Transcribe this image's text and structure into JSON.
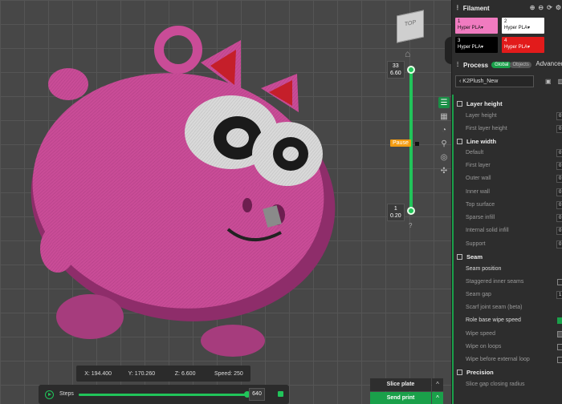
{
  "toolbar": {
    "view_cube_label": "TOP",
    "home_icon": "home-icon",
    "tools": [
      "layers-icon",
      "grid-icon",
      "speed-icon",
      "move-icon",
      "globe-icon",
      "group-icon"
    ]
  },
  "layer_slider": {
    "top_layer": "33",
    "top_height": "6.60",
    "bottom_layer": "1",
    "bottom_height": "0.20",
    "pause_label": "Pause",
    "help_mark": "?"
  },
  "coords": {
    "x": "X: 194.400",
    "y": "Y: 170.260",
    "z": "Z: 6.600",
    "speed": "Speed: 250"
  },
  "steps": {
    "label": "Steps",
    "value": "640",
    "progress_fraction": 1.0
  },
  "actions": {
    "slice_plate": "Slice plate",
    "send_print": "Send print",
    "caret": "^"
  },
  "filament": {
    "title": "Filament",
    "slots": [
      {
        "num": "1",
        "material": "Hyper PLA▾",
        "color": "#f07bc0"
      },
      {
        "num": "2",
        "material": "Hyper PLA▾",
        "color": "#ffffff"
      },
      {
        "num": "3",
        "material": "Hyper PLA▾",
        "color": "#000000"
      },
      {
        "num": "4",
        "material": "Hyper PLA▾",
        "color": "#e21b1b"
      }
    ]
  },
  "process": {
    "title": "Process",
    "global_label": "Global",
    "objects_label": "Objects",
    "advanced_label": "Advanced",
    "preset": "K2Plush_New"
  },
  "settings": {
    "layer_height_title": "Layer height",
    "layer_height": "Layer height",
    "first_layer_height": "First layer height",
    "line_width_title": "Line width",
    "default": "Default",
    "first_layer": "First layer",
    "outer_wall": "Outer wall",
    "inner_wall": "Inner wall",
    "top_surface": "Top surface",
    "sparse_infill": "Sparse infill",
    "internal_solid_infill": "Internal solid infill",
    "support": "Support",
    "seam_title": "Seam",
    "seam_position": "Seam position",
    "staggered_inner_seams": "Staggered inner seams",
    "seam_gap": "Seam gap",
    "scarf_joint_seam": "Scarf joint seam (beta)",
    "role_base_wipe_speed": "Role base wipe speed",
    "wipe_speed": "Wipe speed",
    "wipe_on_loops": "Wipe on loops",
    "wipe_before_external_loop": "Wipe before external loop",
    "precision_title": "Precision",
    "slice_gap_closing_radius": "Slice gap closing radius",
    "value_0": "0",
    "value_1": "1"
  },
  "colors": {
    "accent": "#21c45a",
    "model_pink": "#c94c97",
    "pause": "#f39c12"
  }
}
